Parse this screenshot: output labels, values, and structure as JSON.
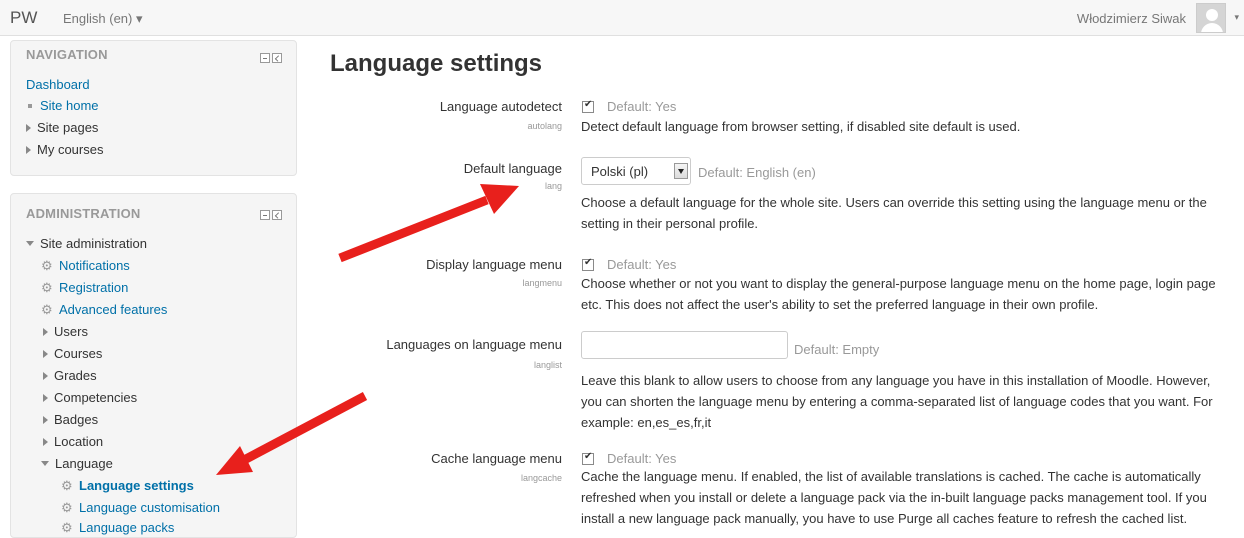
{
  "navbar": {
    "brand": "PW",
    "language": "English (en) ▾",
    "user_name": "Włodzimierz Siwak",
    "user_caret": "▾"
  },
  "navigation_block": {
    "title": "NAVIGATION",
    "dashboard": "Dashboard",
    "site_home": "Site home",
    "site_pages": "Site pages",
    "my_courses": "My courses"
  },
  "admin_block": {
    "title": "ADMINISTRATION",
    "site_admin": "Site administration",
    "notifications": "Notifications",
    "registration": "Registration",
    "advanced_features": "Advanced features",
    "users": "Users",
    "courses": "Courses",
    "grades": "Grades",
    "competencies": "Competencies",
    "badges": "Badges",
    "location": "Location",
    "language": "Language",
    "language_settings": "Language settings",
    "language_customisation": "Language customisation",
    "language_packs": "Language packs"
  },
  "main": {
    "title": "Language settings",
    "settings": {
      "autodetect": {
        "label": "Language autodetect",
        "key": "autolang",
        "default": "Default: Yes",
        "checked": true,
        "description": "Detect default language from browser setting, if disabled site default is used."
      },
      "default_language": {
        "label": "Default language",
        "key": "lang",
        "selected": "Polski (pl)",
        "default": "Default: English (en)",
        "description": "Choose a default language for the whole site. Users can override this setting using the language menu or the setting in their personal profile."
      },
      "display_menu": {
        "label": "Display language menu",
        "key": "langmenu",
        "default": "Default: Yes",
        "checked": true,
        "description": "Choose whether or not you want to display the general-purpose language menu on the home page, login page etc. This does not affect the user's ability to set the preferred language in their own profile."
      },
      "languages_on_menu": {
        "label": "Languages on language menu",
        "key": "langlist",
        "value": "",
        "default": "Default: Empty",
        "description": "Leave this blank to allow users to choose from any language you have in this installation of Moodle. However, you can shorten the language menu by entering a comma-separated list of language codes that you want. For example: en,es_es,fr,it"
      },
      "cache_menu": {
        "label": "Cache language menu",
        "key": "langcache",
        "default": "Default: Yes",
        "checked": true,
        "description": "Cache the language menu. If enabled, the list of available translations is cached. The cache is automatically refreshed when you install or delete a language pack via the in-built language packs management tool. If you install a new language pack manually, you have to use Purge all caches feature to refresh the cached list."
      }
    }
  },
  "colors": {
    "link": "#0070a8",
    "annotation_arrow": "#e8201c",
    "block_bg": "#f5f5f5"
  }
}
